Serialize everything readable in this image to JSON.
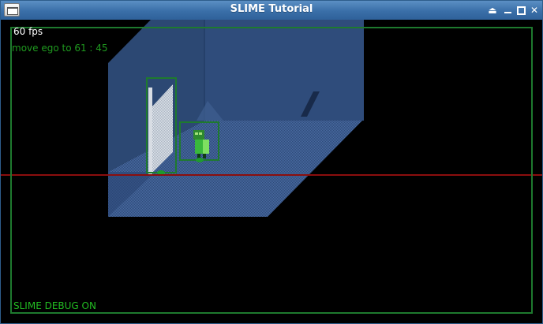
{
  "window": {
    "title": "SLIME Tutorial",
    "controls": [
      "eject",
      "minimize",
      "maximize",
      "close"
    ]
  },
  "hud": {
    "fps": "60 fps",
    "status": "move ego to 61 : 45",
    "debug": "SLIME DEBUG ON"
  },
  "colors": {
    "room_wall": "#2d4a76",
    "room_floor": "#34507f",
    "debug_box": "#1e7a2e",
    "debug_text": "#22bb22",
    "baseline": "#8b0e0e",
    "fps_text": "#ffffff",
    "status_text": "#1f9a1f"
  },
  "scene": {
    "objects": [
      {
        "name": "door",
        "kind": "door"
      },
      {
        "name": "ego",
        "kind": "character"
      }
    ]
  }
}
